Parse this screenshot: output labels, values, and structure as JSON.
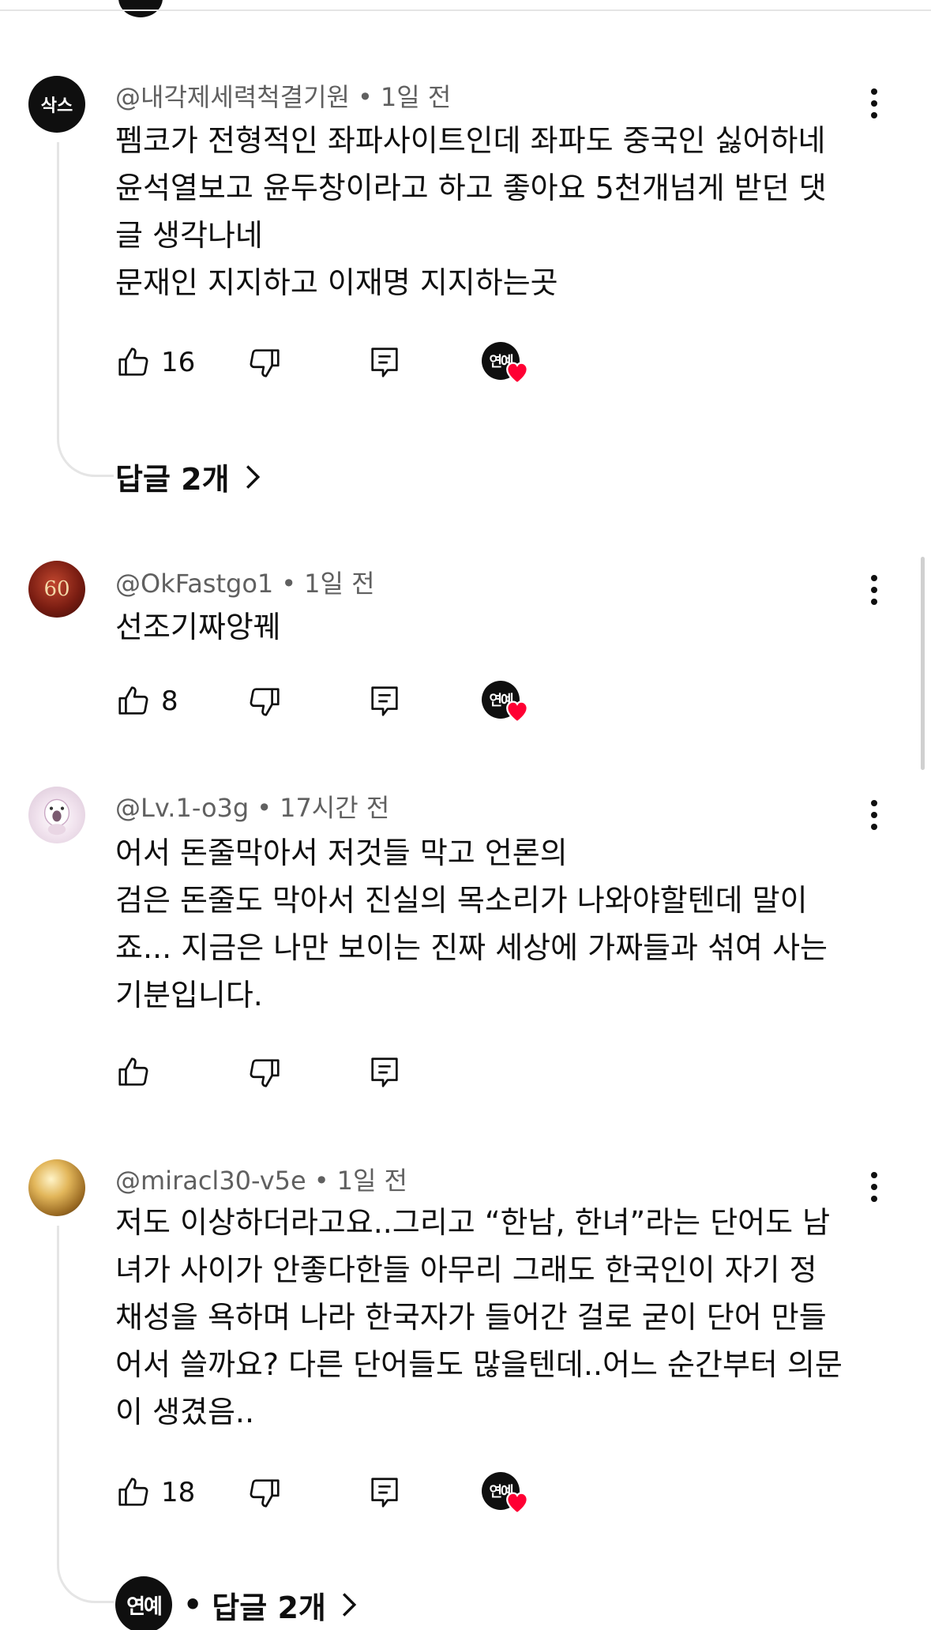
{
  "comments": [
    {
      "avatar_text": "삭스",
      "author": "@내각제세력척결기원",
      "time": "1일 전",
      "lines": [
        "펨코가 전형적인 좌파사이트인데 좌파도 중국인 싫어하네",
        "윤석열보고 윤두창이라고 하고 좋아요 5천개넘게 받던 댓",
        "글 생각나네",
        "문재인 지지하고 이재명 지지하는곳"
      ],
      "likes": "16",
      "creator_heart_avatar": "연예",
      "replies_label": "답글 2개"
    },
    {
      "avatar_text": "60",
      "author": "@OkFastgo1",
      "time": "1일 전",
      "lines": [
        "선조기짜앙꿰"
      ],
      "likes": "8",
      "creator_heart_avatar": "연예"
    },
    {
      "author": "@Lv.1-o3g",
      "time": "17시간 전",
      "lines": [
        "어서 돈줄막아서 저것들 막고 언론의",
        "검은 돈줄도 막아서 진실의 목소리가 나와야할텐데 말이",
        "죠... 지금은 나만 보이는 진짜 세상에 가짜들과 섞여 사는",
        "기분입니다."
      ],
      "likes": ""
    },
    {
      "author": "@miracl30-v5e",
      "time": "1일 전",
      "lines": [
        "저도 이상하더라고요..그리고 “한남, 한녀”라는 단어도 남",
        "녀가 사이가 안좋다한들 아무리 그래도 한국인이 자기 정",
        "채성을 욕하며 나라 한국자가 들어간 걸로  굳이 단어 만들",
        "어서 쓸까요? 다른 단어들도 많을텐데..어느 순간부터 의문",
        "이 생겼음.."
      ],
      "likes": "18",
      "creator_heart_avatar": "연예",
      "replies_avatar": "연예",
      "replies_label": "답글 2개"
    }
  ],
  "meta_separator": "•",
  "colors": {
    "heart": "#ff0033",
    "meta": "#606060",
    "text": "#0f0f0f"
  },
  "icons": [
    "like-icon",
    "dislike-icon",
    "reply-icon",
    "more-vert-icon",
    "heart-icon",
    "chevron-right-icon"
  ]
}
